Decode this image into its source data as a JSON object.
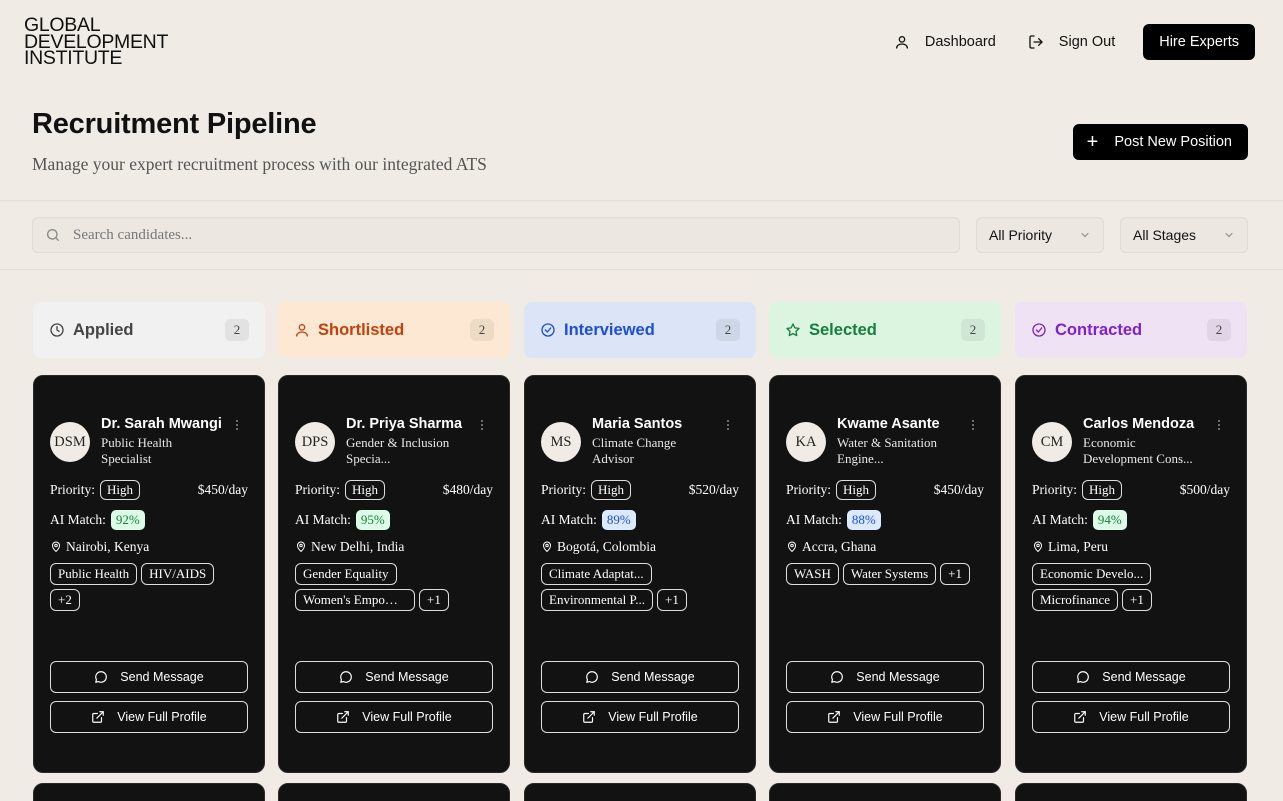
{
  "header": {
    "logo_lines": [
      "GLOBAL",
      "DEVELOPMENT",
      "INSTITUTE"
    ],
    "nav": {
      "dashboard": "Dashboard",
      "sign_out": "Sign Out",
      "hire": "Hire Experts"
    }
  },
  "page": {
    "title": "Recruitment Pipeline",
    "subtitle": "Manage your expert recruitment process with our integrated ATS",
    "post_button": "Post New Position"
  },
  "filters": {
    "search_placeholder": "Search candidates...",
    "priority": "All Priority",
    "stage": "All Stages"
  },
  "columns": [
    {
      "title": "Applied",
      "count": "2",
      "icon": "clock-icon",
      "bg": "#f1f1f1",
      "color": "#444444",
      "card": {
        "initials": "DSM",
        "name": "Dr. Sarah Mwangi",
        "role": "Public Health Specialist",
        "priority_label": "Priority:",
        "priority": "High",
        "rate": "$450/day",
        "match_label": "AI Match:",
        "match": "92%",
        "match_bg": "#dcfce7",
        "match_color": "#15803d",
        "location": "Nairobi, Kenya",
        "tags": [
          "Public Health",
          "HIV/AIDS",
          "+2"
        ]
      }
    },
    {
      "title": "Shortlisted",
      "count": "2",
      "icon": "user-icon",
      "bg": "#fde9d3",
      "color": "#c2410c",
      "card": {
        "initials": "DPS",
        "name": "Dr. Priya Sharma",
        "role": "Gender & Inclusion Specia...",
        "priority_label": "Priority:",
        "priority": "High",
        "rate": "$480/day",
        "match_label": "AI Match:",
        "match": "95%",
        "match_bg": "#dcfce7",
        "match_color": "#15803d",
        "location": "New Delhi, India",
        "tags": [
          "Gender Equality",
          "Women's Empower...",
          "+1"
        ]
      }
    },
    {
      "title": "Interviewed",
      "count": "2",
      "icon": "check-circle-icon",
      "bg": "#dbe5f7",
      "color": "#1d4ed8",
      "card": {
        "initials": "MS",
        "name": "Maria Santos",
        "role": "Climate Change Advisor",
        "priority_label": "Priority:",
        "priority": "High",
        "rate": "$520/day",
        "match_label": "AI Match:",
        "match": "89%",
        "match_bg": "#dbeafe",
        "match_color": "#1d4ed8",
        "location": "Bogotá, Colombia",
        "tags": [
          "Climate Adaptat...",
          "Environmental P...",
          "+1"
        ]
      }
    },
    {
      "title": "Selected",
      "count": "2",
      "icon": "star-icon",
      "bg": "#dbf5e1",
      "color": "#15803d",
      "card": {
        "initials": "KA",
        "name": "Kwame Asante",
        "role": "Water & Sanitation Engine...",
        "priority_label": "Priority:",
        "priority": "High",
        "rate": "$450/day",
        "match_label": "AI Match:",
        "match": "88%",
        "match_bg": "#dbeafe",
        "match_color": "#1d4ed8",
        "location": "Accra, Ghana",
        "tags": [
          "WASH",
          "Water Systems",
          "+1"
        ]
      }
    },
    {
      "title": "Contracted",
      "count": "2",
      "icon": "check-circle-icon",
      "bg": "#efe2f5",
      "color": "#7e22ce",
      "card": {
        "initials": "CM",
        "name": "Carlos Mendoza",
        "role": "Economic Development Cons...",
        "priority_label": "Priority:",
        "priority": "High",
        "rate": "$500/day",
        "match_label": "AI Match:",
        "match": "94%",
        "match_bg": "#dcfce7",
        "match_color": "#15803d",
        "location": "Lima, Peru",
        "tags": [
          "Economic Develo...",
          "Microfinance",
          "+1"
        ]
      }
    }
  ],
  "card_actions": {
    "message": "Send Message",
    "profile": "View Full Profile"
  }
}
